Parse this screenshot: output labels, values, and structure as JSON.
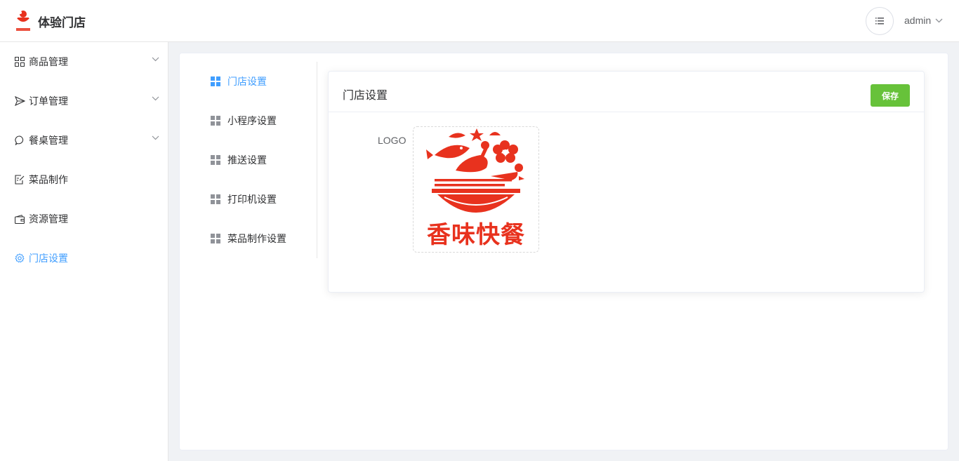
{
  "header": {
    "store_name": "体验门店",
    "user_name": "admin",
    "brand_logo_text": "香味快餐"
  },
  "sidebar": {
    "items": [
      {
        "label": "商品管理",
        "icon": "grid-icon",
        "has_children": true
      },
      {
        "label": "订单管理",
        "icon": "send-icon",
        "has_children": true
      },
      {
        "label": "餐桌管理",
        "icon": "chat-bubble-icon",
        "has_children": true
      },
      {
        "label": "菜品制作",
        "icon": "edit-document-icon",
        "has_children": false
      },
      {
        "label": "资源管理",
        "icon": "wallet-icon",
        "has_children": false
      },
      {
        "label": "门店设置",
        "icon": "gear-icon",
        "has_children": false,
        "active": true
      }
    ]
  },
  "settings_menu": {
    "items": [
      {
        "label": "门店设置",
        "active": true
      },
      {
        "label": "小程序设置"
      },
      {
        "label": "推送设置"
      },
      {
        "label": "打印机设置"
      },
      {
        "label": "菜品制作设置"
      }
    ]
  },
  "store_settings": {
    "title": "门店设置",
    "save_label": "保存",
    "logo_label": "LOGO",
    "logo_text": "香味快餐"
  },
  "colors": {
    "accent": "#409eff",
    "save_green": "#67c23a",
    "logo_red": "#e8321e"
  }
}
